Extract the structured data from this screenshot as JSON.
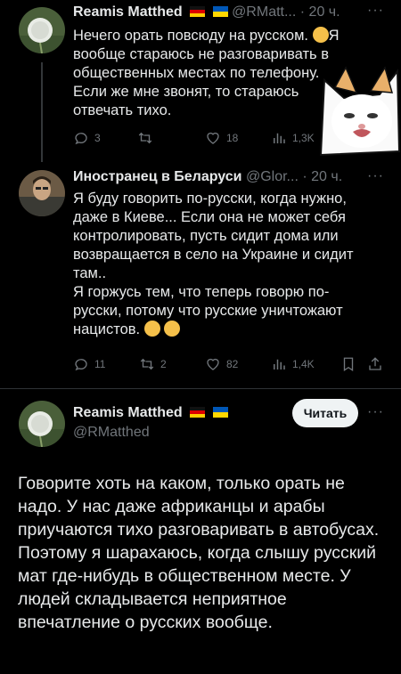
{
  "tweet1": {
    "name": "Reamis Matthed",
    "handle": "@RMatt...",
    "dot": "·",
    "time": "20 ч.",
    "more": "···",
    "text_lines": [
      "Нечего орать повсюду на русском.",
      "вообще стараюсь не разговаривать в",
      "общественных местах по телефону.",
      "Если же мне звонят, то стараюсь",
      "отвечать тихо."
    ],
    "text_line1_end": "Я",
    "replies": "3",
    "retweets": "",
    "likes": "18",
    "views": "1,3K"
  },
  "tweet2": {
    "name": "Иностранец в Беларуси",
    "handle": "@Glor...",
    "dot": "·",
    "time": "20 ч.",
    "more": "···",
    "text_lines": [
      "Я буду говорить по-русски, когда нужно,",
      "даже в Киеве... Если она не может себя",
      "контролировать, пусть сидит дома или",
      "возвращается в село на Украине и сидит",
      "там..",
      "Я горжусь тем, что теперь говорю по-",
      "русски, потому что русские уничтожают",
      "нацистов."
    ],
    "replies": "11",
    "retweets": "2",
    "likes": "82",
    "views": "1,4K"
  },
  "tweet3": {
    "name": "Reamis Matthed",
    "handle": "@RMatthed",
    "more": "···",
    "follow_label": "Читать",
    "text": "Говорите хоть на каком, только орать не надо. У нас даже африканцы и арабы приучаются тихо разговаривать в автобусах. Поэтому я шарахаюсь, когда слышу русский мат где-нибудь в общественном месте. У людей складывается неприятное впечатление о русских вообще."
  },
  "colors": {
    "background": "#000000",
    "text": "#e7e9ea",
    "muted": "#71767b",
    "button": "#eff3f4"
  }
}
